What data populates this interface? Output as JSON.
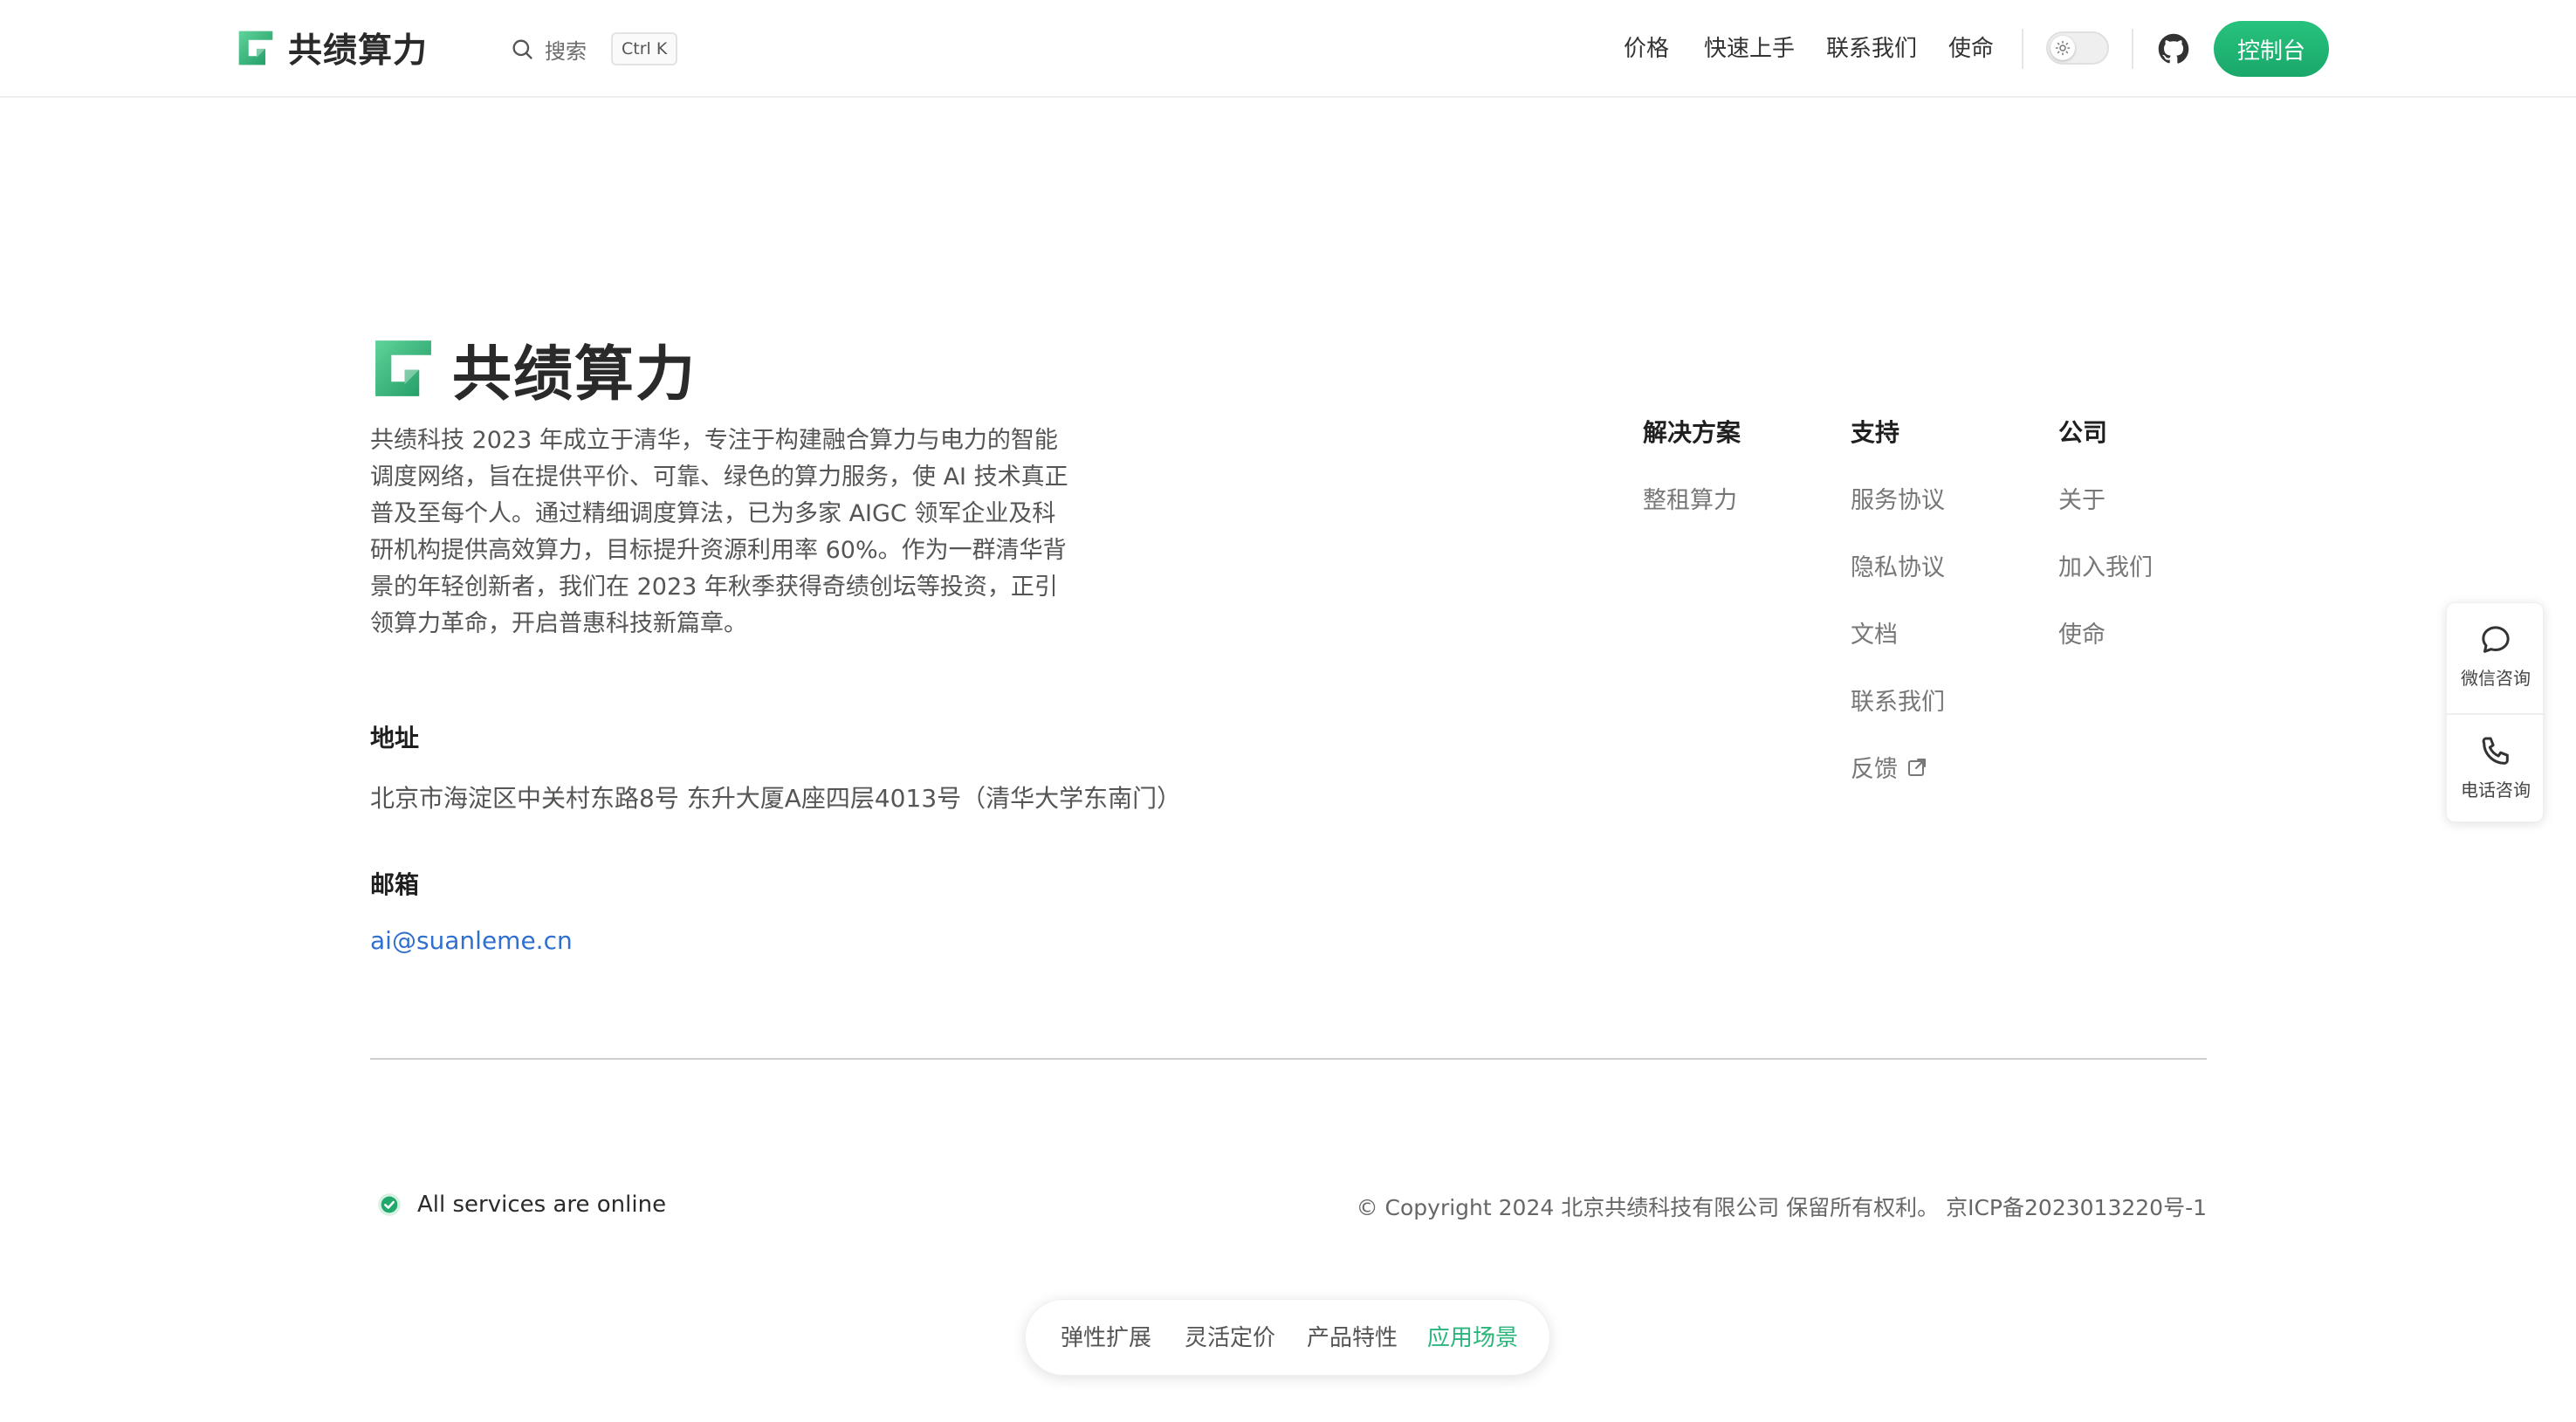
{
  "header": {
    "brand": "共绩算力",
    "search_label": "搜索",
    "search_shortcut": "Ctrl K",
    "nav": [
      {
        "label": "价格"
      },
      {
        "label": "快速上手"
      },
      {
        "label": "联系我们"
      },
      {
        "label": "使命"
      }
    ],
    "console_label": "控制台"
  },
  "footer": {
    "brand": "共绩算力",
    "intro": "共绩科技 2023 年成立于清华，专注于构建融合算力与电力的智能调度网络，旨在提供平价、可靠、绿色的算力服务，使 AI 技术真正普及至每个人。通过精细调度算法，已为多家 AIGC 领军企业及科研机构提供高效算力，目标提升资源利用率 60%。作为一群清华背景的年轻创新者，我们在 2023 年秋季获得奇绩创坛等投资，正引领算力革命，开启普惠科技新篇章。",
    "address_title": "地址",
    "address": "北京市海淀区中关村东路8号 东升大厦A座四层4013号（清华大学东南门）",
    "email_title": "邮箱",
    "email": "ai@suanleme.cn",
    "columns": [
      {
        "title": "解决方案",
        "links": [
          "整租算力"
        ]
      },
      {
        "title": "支持",
        "links": [
          "服务协议",
          "隐私协议",
          "文档",
          "联系我们",
          "反馈"
        ]
      },
      {
        "title": "公司",
        "links": [
          "关于",
          "加入我们",
          "使命"
        ]
      }
    ],
    "status": "All services are online",
    "copyright": "© Copyright 2024 北京共绩科技有限公司 保留所有权利。 京ICP备2023013220号-1"
  },
  "side_contact": {
    "wechat_label": "微信咨询",
    "phone_label": "电话咨询"
  },
  "bottom_tabs": {
    "items": [
      "弹性扩展",
      "灵活定价",
      "产品特性",
      "应用场景"
    ],
    "active": "应用场景"
  },
  "colors": {
    "brand_green": "#1aa86a",
    "link_blue": "#2f6fd0",
    "active_tab": "#2bb57a"
  },
  "icons": {
    "search": "search-icon",
    "sun": "sun-icon",
    "github": "github-icon",
    "external": "external-link-icon",
    "status": "check-circle-icon",
    "wechat": "chat-bubble-icon",
    "phone": "phone-icon"
  }
}
